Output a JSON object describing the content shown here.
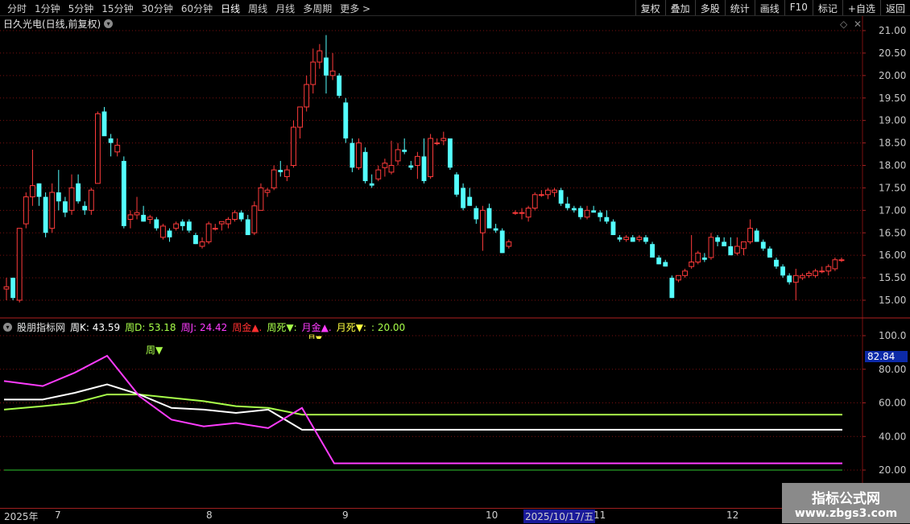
{
  "toolbar": {
    "periods": [
      "分时",
      "1分钟",
      "5分钟",
      "15分钟",
      "30分钟",
      "60分钟",
      "日线",
      "周线",
      "月线",
      "多周期",
      "更多 >"
    ],
    "actions": [
      "复权",
      "叠加",
      "多股",
      "统计",
      "画线",
      "F10",
      "标记",
      "+自选",
      "返回"
    ]
  },
  "stock": {
    "title": "日久光电(日线,前复权)"
  },
  "price_axis": {
    "ticks": [
      "21.00",
      "20.50",
      "20.00",
      "19.50",
      "19.00",
      "18.50",
      "18.00",
      "17.50",
      "17.00",
      "16.50",
      "16.00",
      "15.50",
      "15.00"
    ]
  },
  "indicator": {
    "name": "股朋指标网",
    "k_label": "周K: 43.59",
    "d_label": "周D: 53.18",
    "j_label": "周J: 24.42",
    "gold_label": "周金▲.",
    "death_label": "周死▼:",
    "mgold_label": "月金▲.",
    "mdeath_label": "月死▼:",
    "level_label": ": 20.00",
    "signal_week": "周▼",
    "signal_month": "月▼",
    "axis_ticks": [
      "100.0",
      "80.00",
      "60.00",
      "40.00",
      "20.00"
    ],
    "current_value": "82.84"
  },
  "bottom_axis": {
    "year": "2025年",
    "months": [
      "7",
      "8",
      "9",
      "10",
      "11",
      "12"
    ],
    "cursor_date": "2025/10/17/五"
  },
  "watermark": {
    "line1": "指标公式网",
    "line2": "www.zbgs3.com"
  },
  "colors": {
    "up": "#ff3b3b",
    "down": "#54ffff",
    "k": "#ffffff",
    "d": "#a8ff4a",
    "j": "#ff3cff",
    "grid": "#7a1010"
  },
  "chart_data": {
    "type": "candlestick",
    "ylim": [
      14.85,
      21.2
    ],
    "candles": [
      [
        15.25,
        15.5,
        15.0,
        15.3
      ],
      [
        15.5,
        15.5,
        15.0,
        15.05
      ],
      [
        15.0,
        16.6,
        14.95,
        16.6
      ],
      [
        16.7,
        17.4,
        16.6,
        17.3
      ],
      [
        17.3,
        18.35,
        17.1,
        17.55
      ],
      [
        17.6,
        17.6,
        17.1,
        17.3
      ],
      [
        17.3,
        17.4,
        16.4,
        16.5
      ],
      [
        16.6,
        17.6,
        16.5,
        17.4
      ],
      [
        17.4,
        17.9,
        17.0,
        17.2
      ],
      [
        17.2,
        17.3,
        16.85,
        16.95
      ],
      [
        17.0,
        17.8,
        16.9,
        17.5
      ],
      [
        17.6,
        17.8,
        17.15,
        17.2
      ],
      [
        17.1,
        17.2,
        16.9,
        17.0
      ],
      [
        17.0,
        17.5,
        16.9,
        17.45
      ],
      [
        17.6,
        19.2,
        17.6,
        19.15
      ],
      [
        19.2,
        19.3,
        18.7,
        18.65
      ],
      [
        18.6,
        18.7,
        18.2,
        18.5
      ],
      [
        18.3,
        18.6,
        18.2,
        18.45
      ],
      [
        18.1,
        18.2,
        16.6,
        16.65
      ],
      [
        16.8,
        17.0,
        16.6,
        16.9
      ],
      [
        16.9,
        17.3,
        16.8,
        16.95
      ],
      [
        16.9,
        17.1,
        16.75,
        16.75
      ],
      [
        16.8,
        16.9,
        16.7,
        16.85
      ],
      [
        16.8,
        16.85,
        16.55,
        16.6
      ],
      [
        16.4,
        16.7,
        16.35,
        16.65
      ],
      [
        16.55,
        16.6,
        16.3,
        16.4
      ],
      [
        16.6,
        16.75,
        16.55,
        16.7
      ],
      [
        16.75,
        16.8,
        16.55,
        16.65
      ],
      [
        16.75,
        16.8,
        16.5,
        16.55
      ],
      [
        16.45,
        16.5,
        16.25,
        16.25
      ],
      [
        16.2,
        16.4,
        16.15,
        16.3
      ],
      [
        16.3,
        16.75,
        16.25,
        16.7
      ],
      [
        16.6,
        16.7,
        16.55,
        16.6
      ],
      [
        16.7,
        16.75,
        16.55,
        16.75
      ],
      [
        16.7,
        16.85,
        16.6,
        16.8
      ],
      [
        16.8,
        17.0,
        16.75,
        16.95
      ],
      [
        16.95,
        17.0,
        16.75,
        16.8
      ],
      [
        16.8,
        16.9,
        16.45,
        16.45
      ],
      [
        16.5,
        17.2,
        16.45,
        17.1
      ],
      [
        17.0,
        17.6,
        17.0,
        17.5
      ],
      [
        17.4,
        17.5,
        17.3,
        17.45
      ],
      [
        17.5,
        18.0,
        17.45,
        17.9
      ],
      [
        17.9,
        18.1,
        17.75,
        17.85
      ],
      [
        17.75,
        18.0,
        17.65,
        17.9
      ],
      [
        18.0,
        19.0,
        17.95,
        18.85
      ],
      [
        18.85,
        19.3,
        18.6,
        19.3
      ],
      [
        19.3,
        20.0,
        19.2,
        19.8
      ],
      [
        19.8,
        20.6,
        19.6,
        20.3
      ],
      [
        20.3,
        20.7,
        20.15,
        20.55
      ],
      [
        20.4,
        20.9,
        19.6,
        20.0
      ],
      [
        20.0,
        20.5,
        19.9,
        20.1
      ],
      [
        20.0,
        20.05,
        19.5,
        19.55
      ],
      [
        19.4,
        19.5,
        18.5,
        18.6
      ],
      [
        18.5,
        18.6,
        17.85,
        17.95
      ],
      [
        17.95,
        18.6,
        17.9,
        18.5
      ],
      [
        18.3,
        18.4,
        17.6,
        17.65
      ],
      [
        17.6,
        17.8,
        17.5,
        17.55
      ],
      [
        17.7,
        18.0,
        17.65,
        17.9
      ],
      [
        17.95,
        18.15,
        17.75,
        18.05
      ],
      [
        17.85,
        18.55,
        17.8,
        18.0
      ],
      [
        18.1,
        18.5,
        18.0,
        18.35
      ],
      [
        18.35,
        18.6,
        18.25,
        18.3
      ],
      [
        18.0,
        18.1,
        17.9,
        17.95
      ],
      [
        18.0,
        18.3,
        17.7,
        18.2
      ],
      [
        18.2,
        18.6,
        17.6,
        17.65
      ],
      [
        17.75,
        18.7,
        17.7,
        18.6
      ],
      [
        18.5,
        18.6,
        18.45,
        18.5
      ],
      [
        18.55,
        18.75,
        18.45,
        18.6
      ],
      [
        18.6,
        18.6,
        17.9,
        17.95
      ],
      [
        17.8,
        17.85,
        17.3,
        17.35
      ],
      [
        17.5,
        17.6,
        17.0,
        17.05
      ],
      [
        17.3,
        17.5,
        17.1,
        17.1
      ],
      [
        17.05,
        17.1,
        16.7,
        16.8
      ],
      [
        16.5,
        17.1,
        16.1,
        17.0
      ],
      [
        17.05,
        17.15,
        16.65,
        16.6
      ],
      [
        16.6,
        16.7,
        16.5,
        16.55
      ],
      [
        16.55,
        16.6,
        16.05,
        16.05
      ],
      [
        16.2,
        16.35,
        16.15,
        16.3
      ],
      [
        16.95,
        17.0,
        16.9,
        16.95
      ],
      [
        16.95,
        17.05,
        16.8,
        16.95
      ],
      [
        16.85,
        17.1,
        16.75,
        17.05
      ],
      [
        17.05,
        17.4,
        17.0,
        17.35
      ],
      [
        17.35,
        17.45,
        17.3,
        17.35
      ],
      [
        17.35,
        17.5,
        17.25,
        17.45
      ],
      [
        17.4,
        17.5,
        17.3,
        17.45
      ],
      [
        17.45,
        17.5,
        17.1,
        17.15
      ],
      [
        17.15,
        17.3,
        17.0,
        17.05
      ],
      [
        17.05,
        17.1,
        16.95,
        17.0
      ],
      [
        17.05,
        17.1,
        16.8,
        16.85
      ],
      [
        16.85,
        17.1,
        16.8,
        17.0
      ],
      [
        17.0,
        17.1,
        16.95,
        16.95
      ],
      [
        16.95,
        17.0,
        16.75,
        16.85
      ],
      [
        16.85,
        17.0,
        16.7,
        16.75
      ],
      [
        16.75,
        16.8,
        16.45,
        16.45
      ],
      [
        16.4,
        16.45,
        16.3,
        16.35
      ],
      [
        16.35,
        16.45,
        16.3,
        16.4
      ],
      [
        16.4,
        16.45,
        16.3,
        16.3
      ],
      [
        16.35,
        16.45,
        16.3,
        16.4
      ],
      [
        16.4,
        16.45,
        16.25,
        16.3
      ],
      [
        16.25,
        16.3,
        15.95,
        15.95
      ],
      [
        15.95,
        16.0,
        15.8,
        15.8
      ],
      [
        15.85,
        15.9,
        15.75,
        15.75
      ],
      [
        15.5,
        15.55,
        15.05,
        15.05
      ],
      [
        15.45,
        15.55,
        15.4,
        15.55
      ],
      [
        15.55,
        15.7,
        15.5,
        15.65
      ],
      [
        15.75,
        16.45,
        15.7,
        15.85
      ],
      [
        15.85,
        16.1,
        15.8,
        16.05
      ],
      [
        15.95,
        16.05,
        15.85,
        15.9
      ],
      [
        15.95,
        16.5,
        15.9,
        16.4
      ],
      [
        16.4,
        16.45,
        16.2,
        16.3
      ],
      [
        16.3,
        16.4,
        16.2,
        16.2
      ],
      [
        16.2,
        16.4,
        16.0,
        16.0
      ],
      [
        16.05,
        16.4,
        16.0,
        16.2
      ],
      [
        16.15,
        16.3,
        16.0,
        16.3
      ],
      [
        16.3,
        16.8,
        16.25,
        16.6
      ],
      [
        16.55,
        16.6,
        16.3,
        16.3
      ],
      [
        16.3,
        16.35,
        16.1,
        16.15
      ],
      [
        16.15,
        16.2,
        15.95,
        15.95
      ],
      [
        15.9,
        15.95,
        15.7,
        15.75
      ],
      [
        15.75,
        15.8,
        15.5,
        15.55
      ],
      [
        15.55,
        15.6,
        15.35,
        15.4
      ],
      [
        15.4,
        15.7,
        15.0,
        15.55
      ],
      [
        15.5,
        15.6,
        15.45,
        15.55
      ],
      [
        15.55,
        15.65,
        15.5,
        15.6
      ],
      [
        15.55,
        15.7,
        15.5,
        15.65
      ],
      [
        15.65,
        15.75,
        15.6,
        15.65
      ],
      [
        15.65,
        15.8,
        15.55,
        15.75
      ],
      [
        15.7,
        15.95,
        15.65,
        15.9
      ],
      [
        15.9,
        15.95,
        15.85,
        15.9
      ]
    ],
    "indicator_ylim": [
      14,
      108
    ],
    "k_series": [
      62,
      62,
      62,
      66,
      70,
      73,
      70,
      65,
      60,
      58,
      57,
      56,
      55,
      57,
      57,
      57,
      44,
      44,
      44,
      44,
      44,
      44,
      44,
      44,
      44,
      44,
      44,
      44,
      44,
      44,
      44,
      44,
      44
    ],
    "d_series": [
      56,
      58,
      58,
      61,
      63,
      65,
      65,
      64,
      63,
      62,
      61,
      60,
      59,
      58,
      57,
      56,
      53,
      53,
      53,
      53,
      53,
      53,
      53,
      53,
      53,
      53,
      53,
      53,
      53,
      53,
      53,
      53,
      53
    ],
    "j_series": [
      74,
      72,
      70,
      76,
      82,
      88,
      80,
      68,
      56,
      46,
      46,
      48,
      45,
      53,
      57,
      30,
      24,
      24,
      24,
      24,
      24,
      24,
      24,
      24,
      24,
      24,
      24,
      24,
      24,
      24,
      24,
      24,
      24
    ],
    "level": 20
  }
}
